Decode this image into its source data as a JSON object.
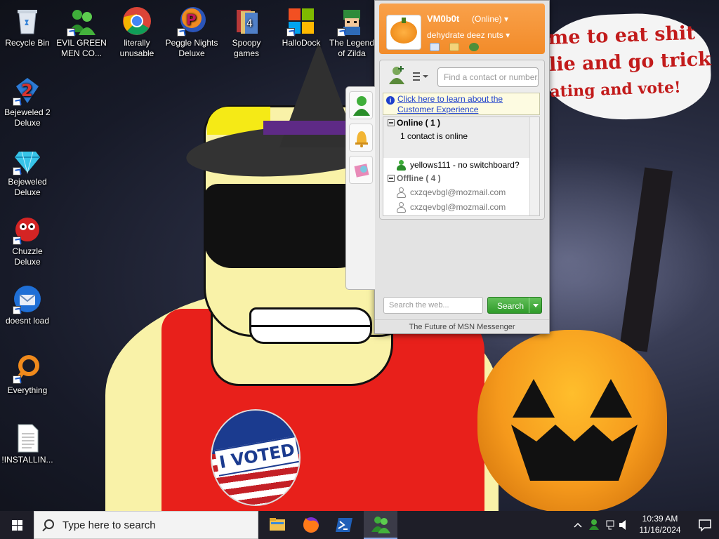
{
  "wallpaper": {
    "speech_lines": [
      "me to eat shit",
      "lie and go trick",
      "ating and vote!"
    ],
    "badge_text": "I VOTED"
  },
  "desktop_icons": [
    {
      "label": "Recycle Bin",
      "icon": "recycle-bin-icon"
    },
    {
      "label": "EVIL GREEN MEN CO...",
      "icon": "msn-buddies-icon"
    },
    {
      "label": "literally unusable",
      "icon": "chrome-icon"
    },
    {
      "label": "Peggle Nights Deluxe",
      "icon": "peggle-icon"
    },
    {
      "label": "Spoopy games",
      "icon": "folder-icon"
    },
    {
      "label": "HalloDock",
      "icon": "windows-logo-icon"
    },
    {
      "label": "The Legend of Zilda",
      "icon": "zilda-icon"
    },
    {
      "label": "Bejeweled 2 Deluxe",
      "icon": "bejeweled2-icon"
    },
    {
      "label": "Bejeweled Deluxe",
      "icon": "diamond-icon"
    },
    {
      "label": "Chuzzle Deluxe",
      "icon": "chuzzle-icon"
    },
    {
      "label": "doesnt load",
      "icon": "thunderbird-icon"
    },
    {
      "label": "Everything",
      "icon": "everything-search-icon"
    },
    {
      "label": "!INSTALLIN...",
      "icon": "text-document-icon"
    }
  ],
  "msn": {
    "display_name": "VM0b0t",
    "status": "(Online) ▾",
    "personal_message": "dehydrate deez nuts  ▾",
    "find_placeholder": "Find a contact or number...",
    "notice_line1": "Click here to learn about the",
    "notice_line2": "Customer Experience",
    "groups": {
      "online_header": "Online ( 1 )",
      "online_sub": "1 contact is online",
      "offline_header": "Offline ( 4 )"
    },
    "contacts_online": [
      "yellows111 - no switchboard?"
    ],
    "contacts_offline": [
      "cxzqevbgl@mozmail.com",
      "cxzqevbgl@mozmail.com"
    ],
    "search_placeholder": "Search the web...",
    "search_button": "Search",
    "footer": "The Future of MSN Messenger"
  },
  "taskbar": {
    "search_placeholder": "Type here to search",
    "apps": [
      "file-explorer-icon",
      "firefox-icon",
      "powershell-icon",
      "msn-messenger-icon"
    ],
    "time": "10:39 AM",
    "date": "11/16/2024"
  },
  "colors": {
    "msn_orange": "#f28b29",
    "online_green": "#2f9b2a",
    "link_blue": "#1d3fcc",
    "taskbar": "#1e1e28"
  }
}
